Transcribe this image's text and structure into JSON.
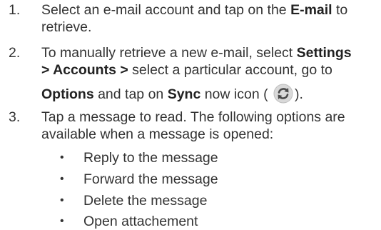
{
  "steps": [
    {
      "number": "1.",
      "line1_prefix": "Select an e-mail account and tap on the ",
      "line1_bold": "E-mail",
      "line1_suffix": " to",
      "line2": "retrieve."
    },
    {
      "number": "2.",
      "line1_prefix": "To manually retrieve a new e-mail, select ",
      "line1_bold": "Settings",
      "line2_bold": "> Accounts >",
      "line2_suffix": " select a particular account, go to",
      "line3_bold1": "Options",
      "line3_mid": " and tap on ",
      "line3_bold2": "Sync",
      "line3_suffix_a": " now icon (",
      "line3_suffix_b": ").",
      "icon": "sync-icon"
    },
    {
      "number": "3.",
      "line1": "Tap a message to read. The following options are",
      "line2": "available when a message is opened:"
    }
  ],
  "options": [
    "Reply to the message",
    "Forward the message",
    "Delete the message",
    "Open attachement"
  ],
  "bullet_char": "•",
  "colors": {
    "text": "#333333",
    "icon_ring": "#4a4a4a",
    "icon_fill": "#d9d9d9"
  }
}
